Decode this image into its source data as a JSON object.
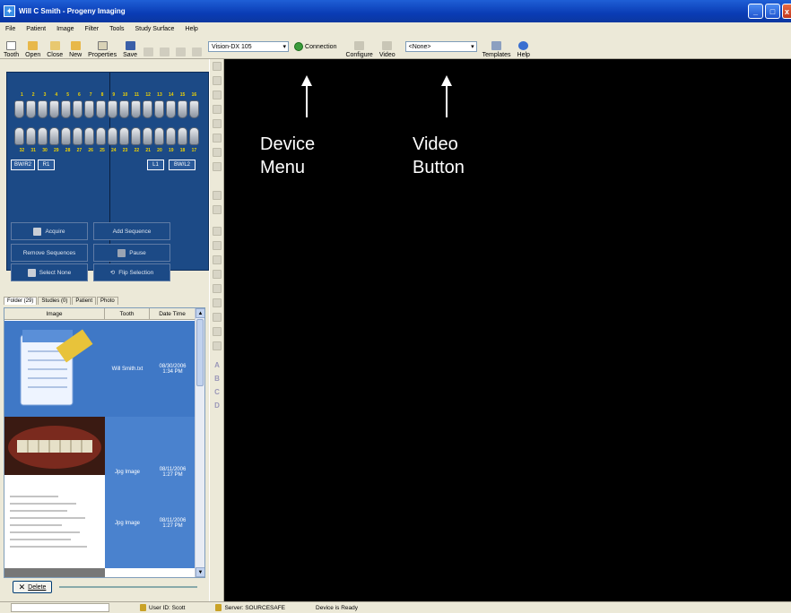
{
  "window": {
    "title": "Will C Smith - Progeny Imaging",
    "buttons": [
      "_",
      "□",
      "x"
    ]
  },
  "menu": [
    "File",
    "Patient",
    "Image",
    "Filter",
    "Tools",
    "Study Surface",
    "Help"
  ],
  "toolbar": {
    "tooth": "Tooth",
    "open": "Open",
    "close": "Close",
    "new": "New",
    "properties": "Properties",
    "save": "Save",
    "device_select": "Vision-DX 105",
    "connection": "Connection",
    "configure": "Configure",
    "video": "Video",
    "template_select": "<None>",
    "templates": "Templates",
    "help": "Help"
  },
  "tooth_chart": {
    "upper_numbers": [
      "1",
      "2",
      "3",
      "4",
      "5",
      "6",
      "7",
      "8",
      "9",
      "10",
      "11",
      "12",
      "13",
      "14",
      "15",
      "16"
    ],
    "lower_numbers": [
      "32",
      "31",
      "30",
      "29",
      "28",
      "27",
      "26",
      "25",
      "24",
      "23",
      "22",
      "21",
      "20",
      "19",
      "18",
      "17"
    ],
    "bitewings": [
      "BW/R2",
      "R1",
      "L1",
      "BW/L2"
    ]
  },
  "actions": {
    "acquire": "Acquire",
    "add_sequence": "Add Sequence",
    "remove_sequences": "Remove Sequences",
    "pause": "Pause",
    "select_none": "Select None",
    "flip_selection": "Flip Selection"
  },
  "tabs": [
    "Folder (29)",
    "Studies (0)",
    "Patient",
    "Photo"
  ],
  "grid": {
    "headers": [
      "Image",
      "Tooth",
      "Date Time"
    ],
    "rows": [
      {
        "tooth": "Will Smith.txt",
        "date": "08/30/2006",
        "time": "1:34 PM"
      },
      {
        "tooth": "Jpg Image",
        "date": "08/11/2006",
        "time": "1:27 PM"
      },
      {
        "tooth": "Jpg Image",
        "date": "08/11/2006",
        "time": "1:27 PM"
      }
    ]
  },
  "delete_label": "Delete",
  "sidebar_letters": [
    "A",
    "B",
    "C",
    "D"
  ],
  "annotations": {
    "device_menu": [
      "Device",
      "Menu"
    ],
    "video_button": [
      "Video",
      "Button"
    ]
  },
  "status": {
    "user": "User ID:  Scott",
    "server": "Server:  SOURCESAFE",
    "device": "Device is Ready"
  },
  "colors": {
    "title_blue": "#0a3cb5",
    "chart_blue": "#1c4a86",
    "viewer_bg": "#000000",
    "grid_selected": "#3f78c6"
  }
}
